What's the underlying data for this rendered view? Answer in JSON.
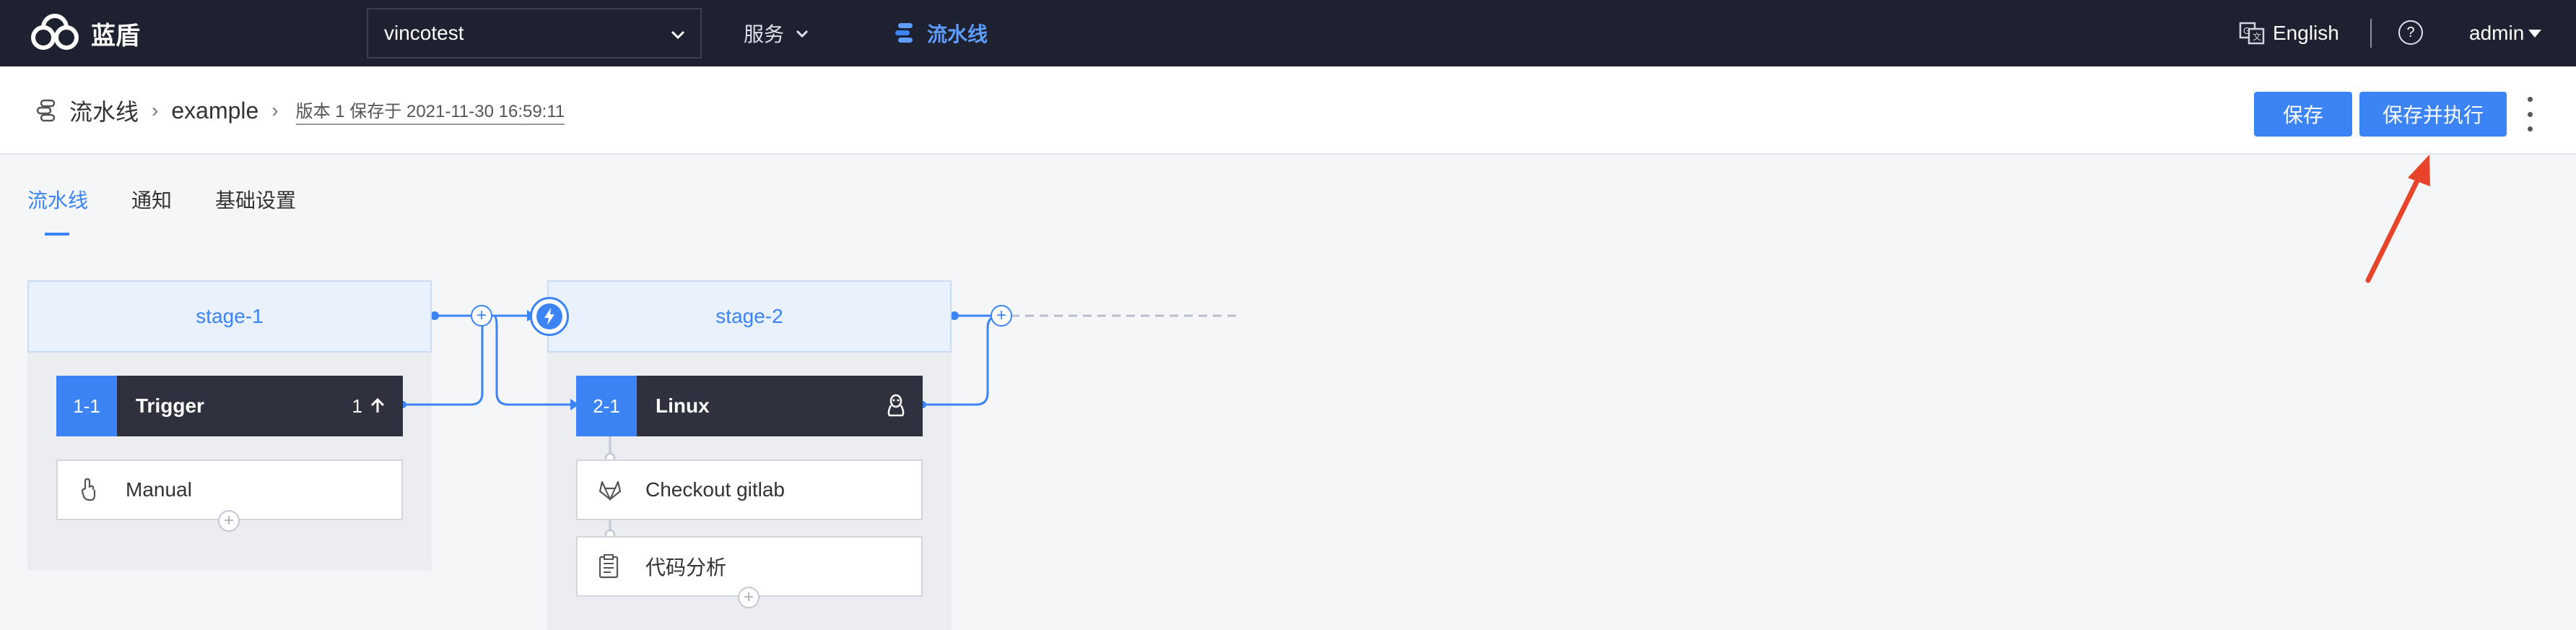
{
  "topbar": {
    "brand": "蓝盾",
    "project": "vincotest",
    "service_menu": "服务",
    "pipeline_nav": "流水线",
    "language": "English",
    "help": "?",
    "user": "admin"
  },
  "breadcrumb": {
    "root": "流水线",
    "pipeline_name": "example",
    "version_info": "版本 1 保存于 2021-11-30 16:59:11"
  },
  "actions": {
    "save": "保存",
    "save_and_run": "保存并执行"
  },
  "tabs": [
    {
      "label": "流水线",
      "active": true
    },
    {
      "label": "通知",
      "active": false
    },
    {
      "label": "基础设置",
      "active": false
    }
  ],
  "stages": [
    {
      "name": "stage-1",
      "job": {
        "index": "1-1",
        "name": "Trigger",
        "count": "1",
        "icon": "arrow-up-icon"
      },
      "steps": [
        {
          "label": "Manual",
          "icon": "hand-pointer-icon"
        }
      ]
    },
    {
      "name": "stage-2",
      "job": {
        "index": "2-1",
        "name": "Linux",
        "icon": "linux-icon"
      },
      "steps": [
        {
          "label": "Checkout gitlab",
          "icon": "gitlab-icon"
        },
        {
          "label": "代码分析",
          "icon": "clipboard-icon"
        }
      ]
    }
  ],
  "colors": {
    "accent": "#3c84f6",
    "topbar": "#1e2130",
    "job_bar": "#2f323e",
    "annotation_arrow": "#e8442b"
  }
}
